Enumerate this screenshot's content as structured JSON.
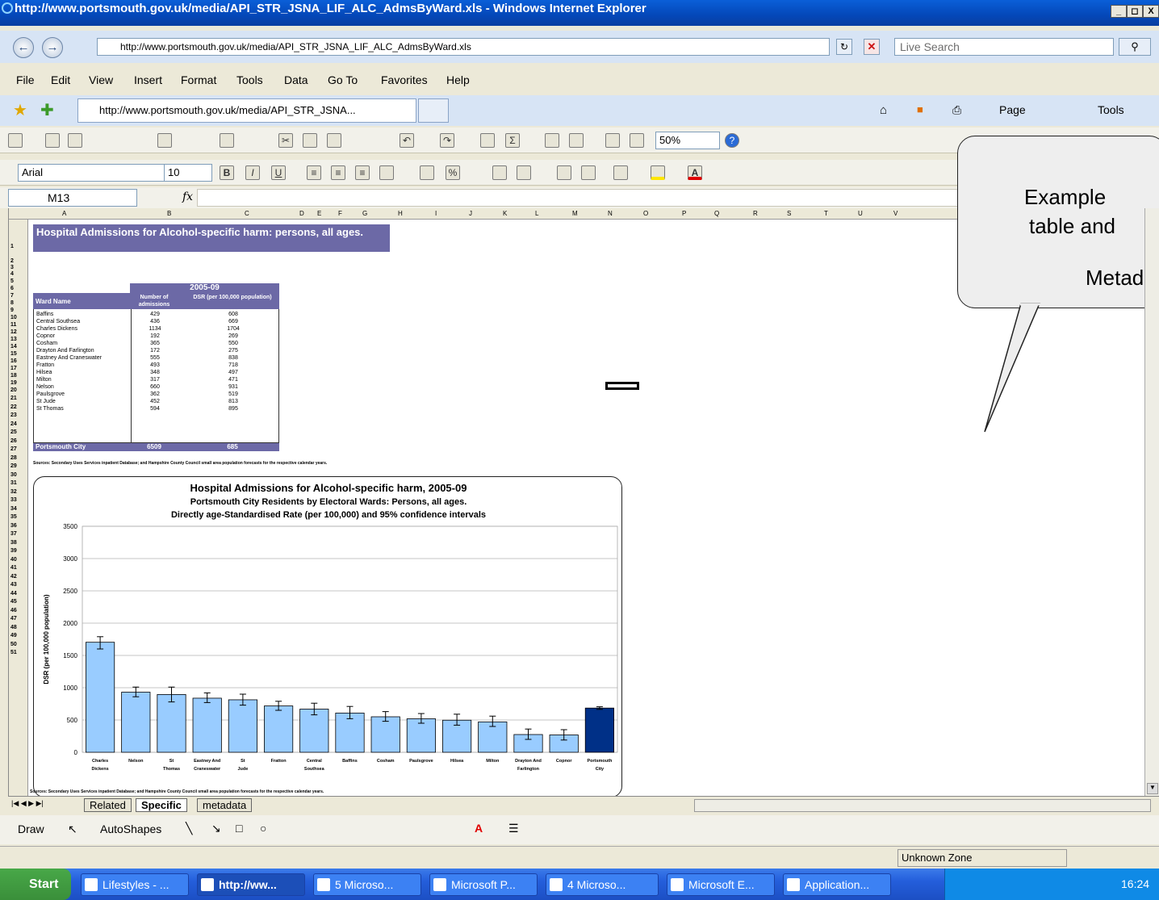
{
  "window": {
    "title": "http://www.portsmouth.gov.uk/media/API_STR_JSNA_LIF_ALC_AdmsByWard.xls - Windows Internet Explorer",
    "min": "_",
    "max": "×",
    "close": "X"
  },
  "address": {
    "url": "http://www.portsmouth.gov.uk/media/API_STR_JSNA_LIF_ALC_AdmsByWard.xls",
    "search_placeholder": "Live Search"
  },
  "menu": [
    "File",
    "Edit",
    "View",
    "Insert",
    "Format",
    "Tools",
    "Data",
    "Go To",
    "Favorites",
    "Help"
  ],
  "favorites": {
    "tab_title": "http://www.portsmouth.gov.uk/media/API_STR_JSNA...",
    "page": "Page",
    "tools": "Tools"
  },
  "excel": {
    "zoom": "50%",
    "font": "Arial",
    "size": "10",
    "cell_ref": "M13",
    "fx": "fx",
    "columns": [
      "A",
      "B",
      "C",
      "D",
      "E",
      "F",
      "G",
      "H",
      "I",
      "J",
      "K",
      "L",
      "M",
      "N",
      "O",
      "P",
      "Q",
      "R",
      "S",
      "T",
      "U",
      "V"
    ],
    "rows": [
      "1",
      "2",
      "3",
      "4",
      "5",
      "6",
      "7",
      "8",
      "9",
      "10",
      "11",
      "12",
      "13",
      "14",
      "15",
      "16",
      "17",
      "18",
      "19",
      "20",
      "21",
      "22",
      "23",
      "24",
      "25",
      "26",
      "27",
      "28",
      "29",
      "30",
      "31",
      "32",
      "33",
      "34",
      "35",
      "36",
      "37",
      "38",
      "39",
      "40",
      "41",
      "42",
      "43",
      "44",
      "45",
      "46",
      "47",
      "48",
      "49",
      "50",
      "51"
    ]
  },
  "sheet": {
    "title": "Hospital Admissions for Alcohol-specific harm: persons, all ages.",
    "period": "2005-09",
    "col_ward": "Ward Name",
    "col_num": "Number of admissions",
    "col_dsr": "DSR (per 100,000 population)",
    "wards": [
      {
        "name": "Baffins",
        "num": "429",
        "dsr": "608"
      },
      {
        "name": "Central Southsea",
        "num": "436",
        "dsr": "669"
      },
      {
        "name": "Charles Dickens",
        "num": "1134",
        "dsr": "1704"
      },
      {
        "name": "Copnor",
        "num": "192",
        "dsr": "269"
      },
      {
        "name": "Cosham",
        "num": "365",
        "dsr": "550"
      },
      {
        "name": "Drayton And Farlington",
        "num": "172",
        "dsr": "275"
      },
      {
        "name": "Eastney And Craneswater",
        "num": "555",
        "dsr": "838"
      },
      {
        "name": "Fratton",
        "num": "493",
        "dsr": "718"
      },
      {
        "name": "Hilsea",
        "num": "348",
        "dsr": "497"
      },
      {
        "name": "Milton",
        "num": "317",
        "dsr": "471"
      },
      {
        "name": "Nelson",
        "num": "660",
        "dsr": "931"
      },
      {
        "name": "Paulsgrove",
        "num": "362",
        "dsr": "519"
      },
      {
        "name": "St Jude",
        "num": "452",
        "dsr": "813"
      },
      {
        "name": "St Thomas",
        "num": "594",
        "dsr": "895"
      }
    ],
    "total": {
      "name": "Portsmouth City",
      "num": "6509",
      "dsr": "685"
    },
    "source1": "Sources: Secondary Uses Services inpatient Database; and Hampshire County Council small area population forecasts for the respective calendar years.",
    "source2": "Sources: Secondary Uses Services inpatient Database; and Hampshire County Council small area population forecasts for the respective calendar years."
  },
  "chart_data": {
    "type": "bar",
    "title": "Hospital Admissions for Alcohol-specific harm, 2005-09",
    "subtitle1": "Portsmouth City Residents by Electoral Wards: Persons, all ages.",
    "subtitle2": "Directly age-Standardised Rate (per 100,000) and 95% confidence intervals",
    "ylabel": "DSR (per 100,000 population)",
    "ylim": [
      0,
      3500
    ],
    "yticks": [
      "0",
      "500",
      "1000",
      "1500",
      "2000",
      "2500",
      "3000",
      "3500"
    ],
    "categories": [
      "Charles Dickens",
      "Nelson",
      "St Thomas",
      "Eastney And Craneswater",
      "St Jude",
      "Fratton",
      "Central Southsea",
      "Baffins",
      "Cosham",
      "Paulsgrove",
      "Hilsea",
      "Milton",
      "Drayton And Farlington",
      "Copnor",
      "Portsmouth City"
    ],
    "values": [
      1704,
      931,
      895,
      838,
      813,
      718,
      669,
      608,
      550,
      519,
      497,
      471,
      275,
      269,
      685
    ],
    "ci_low": [
      1600,
      860,
      780,
      770,
      730,
      650,
      580,
      520,
      480,
      450,
      420,
      400,
      200,
      190,
      665
    ],
    "ci_high": [
      1790,
      1010,
      1010,
      920,
      900,
      790,
      760,
      710,
      630,
      600,
      590,
      560,
      360,
      350,
      705
    ],
    "colors": {
      "bar": "#99ccff",
      "total": "#003087",
      "edge": "#000000"
    },
    "grid": true
  },
  "callout": {
    "line1": "Example",
    "line2": "table and",
    "line3": "Metad"
  },
  "sheet_tabs": [
    "Related",
    "Specific",
    "metadata"
  ],
  "drawbar": {
    "draw": "Draw",
    "autoshapes": "AutoShapes"
  },
  "status": {
    "zone": "Unknown Zone"
  },
  "taskbar": {
    "start": "Start",
    "items": [
      "Lifestyles - ...",
      "http://ww...",
      "5 Microso...",
      "Microsoft P...",
      "4 Microso...",
      "Microsoft E...",
      "Application..."
    ],
    "clock": "16:24"
  }
}
